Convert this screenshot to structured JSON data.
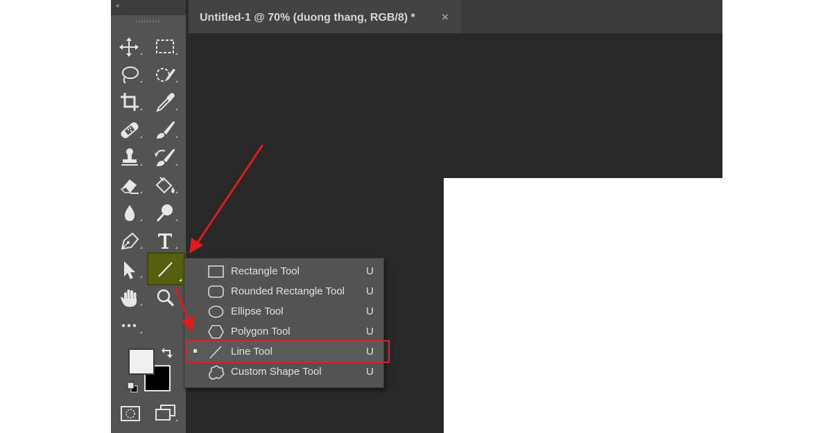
{
  "app": {
    "collapse_label": "«"
  },
  "document_tab": {
    "title": "Untitled-1 @ 70% (duong thang, RGB/8) *",
    "close_label": "×"
  },
  "toolbar": {
    "tools": [
      {
        "name": "move-tool",
        "icon": "move-icon"
      },
      {
        "name": "rectangular-marquee-tool",
        "icon": "marquee-icon"
      },
      {
        "name": "lasso-tool",
        "icon": "lasso-icon"
      },
      {
        "name": "quick-selection-tool",
        "icon": "quick-selection-icon"
      },
      {
        "name": "crop-tool",
        "icon": "crop-icon"
      },
      {
        "name": "eyedropper-tool",
        "icon": "eyedropper-icon"
      },
      {
        "name": "spot-healing-tool",
        "icon": "bandage-icon"
      },
      {
        "name": "brush-tool",
        "icon": "brush-icon"
      },
      {
        "name": "clone-stamp-tool",
        "icon": "stamp-icon"
      },
      {
        "name": "history-brush-tool",
        "icon": "history-brush-icon"
      },
      {
        "name": "eraser-tool",
        "icon": "eraser-icon"
      },
      {
        "name": "paint-bucket-tool",
        "icon": "paint-bucket-icon"
      },
      {
        "name": "blur-tool",
        "icon": "drop-icon"
      },
      {
        "name": "dodge-tool",
        "icon": "dodge-icon"
      },
      {
        "name": "pen-tool",
        "icon": "pen-icon"
      },
      {
        "name": "type-tool",
        "icon": "type-icon",
        "glyph": "T"
      },
      {
        "name": "path-selection-tool",
        "icon": "arrow-pointer-icon"
      },
      {
        "name": "line-tool",
        "icon": "line-icon",
        "active": true
      },
      {
        "name": "hand-tool",
        "icon": "hand-icon"
      },
      {
        "name": "zoom-tool",
        "icon": "magnifier-icon"
      },
      {
        "name": "edit-toolbar",
        "icon": "more-icon",
        "glyph": "•••"
      }
    ],
    "foreground_color": "#f0f0f0",
    "background_color": "#000000"
  },
  "shape_flyout": {
    "items": [
      {
        "label": "Rectangle Tool",
        "shortcut": "U",
        "icon": "rectangle-icon",
        "selected": false
      },
      {
        "label": "Rounded Rectangle Tool",
        "shortcut": "U",
        "icon": "rounded-rectangle-icon",
        "selected": false
      },
      {
        "label": "Ellipse Tool",
        "shortcut": "U",
        "icon": "ellipse-icon",
        "selected": false
      },
      {
        "label": "Polygon Tool",
        "shortcut": "U",
        "icon": "polygon-icon",
        "selected": false
      },
      {
        "label": "Line Tool",
        "shortcut": "U",
        "icon": "line-icon",
        "selected": true
      },
      {
        "label": "Custom Shape Tool",
        "shortcut": "U",
        "icon": "custom-shape-icon",
        "selected": false
      }
    ]
  },
  "colors": {
    "annotation_red": "#e01b1b",
    "highlight_box": "#555f0f",
    "workspace": "#282828",
    "toolbar": "#535353"
  }
}
